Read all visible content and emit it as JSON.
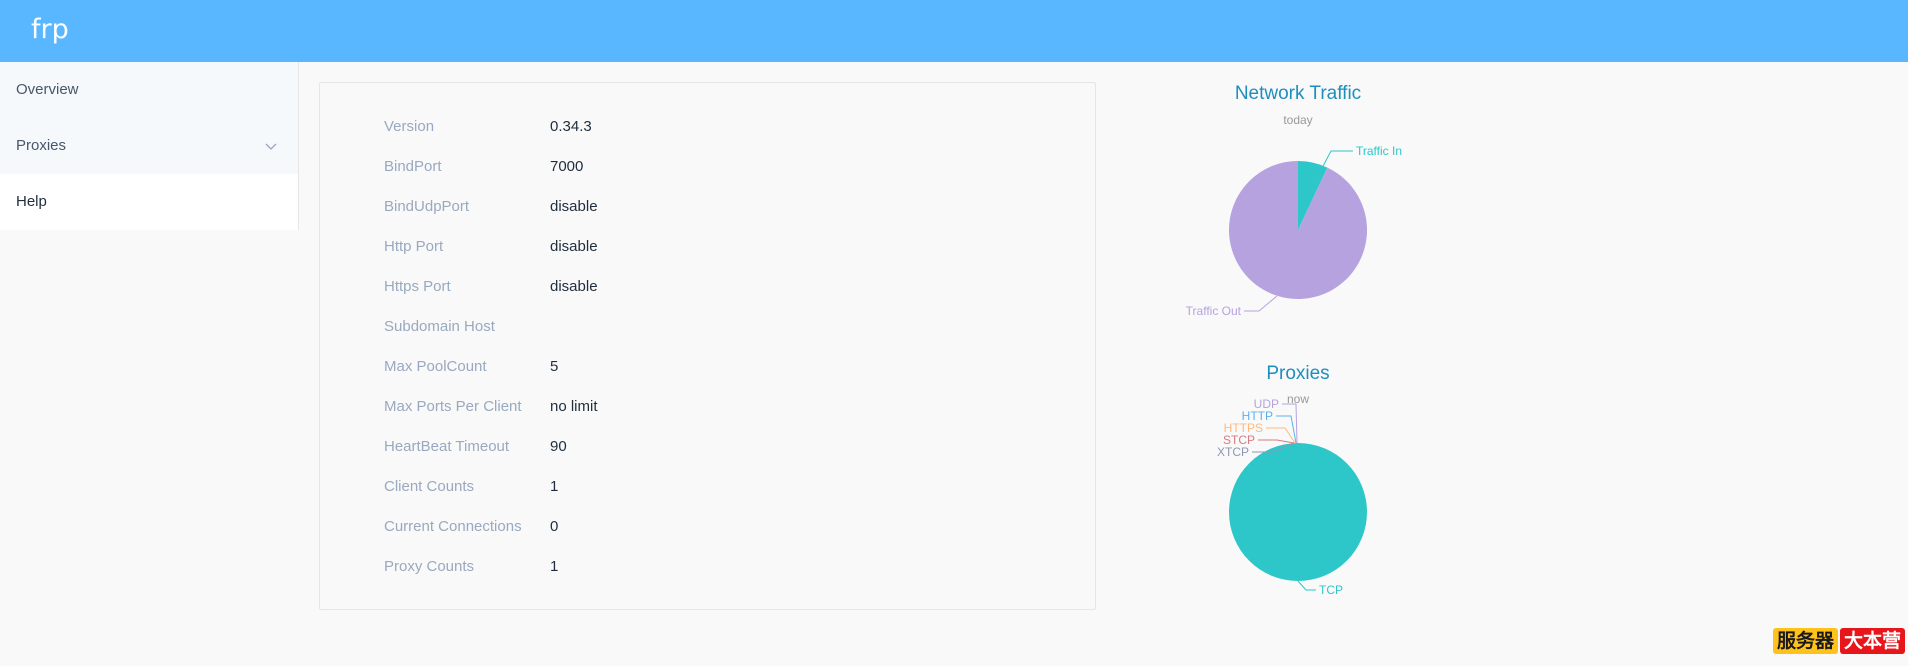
{
  "app": {
    "title": "frp"
  },
  "sidebar": {
    "items": [
      {
        "label": "Overview"
      },
      {
        "label": "Proxies"
      },
      {
        "label": "Help"
      }
    ]
  },
  "server_info": [
    {
      "label": "Version",
      "value": "0.34.3"
    },
    {
      "label": "BindPort",
      "value": "7000"
    },
    {
      "label": "BindUdpPort",
      "value": "disable"
    },
    {
      "label": "Http Port",
      "value": "disable"
    },
    {
      "label": "Https Port",
      "value": "disable"
    },
    {
      "label": "Subdomain Host",
      "value": ""
    },
    {
      "label": "Max PoolCount",
      "value": "5"
    },
    {
      "label": "Max Ports Per Client",
      "value": "no limit"
    },
    {
      "label": "HeartBeat Timeout",
      "value": "90"
    },
    {
      "label": "Client Counts",
      "value": "1"
    },
    {
      "label": "Current Connections",
      "value": "0"
    },
    {
      "label": "Proxy Counts",
      "value": "1"
    }
  ],
  "watermark": {
    "part1": "服务器",
    "part2": "大本营"
  },
  "chart_data": [
    {
      "type": "pie",
      "title": "Network Traffic",
      "subtitle": "today",
      "slices": [
        {
          "label": "Traffic In",
          "value": 7,
          "color": "#2ec7c9"
        },
        {
          "label": "Traffic Out",
          "value": 93,
          "color": "#b6a2de"
        }
      ]
    },
    {
      "type": "pie",
      "title": "Proxies",
      "subtitle": "now",
      "slices": [
        {
          "label": "TCP",
          "value": 1,
          "color": "#2ec7c9"
        },
        {
          "label": "UDP",
          "value": 0,
          "color": "#b6a2de"
        },
        {
          "label": "HTTP",
          "value": 0,
          "color": "#5ab1ef"
        },
        {
          "label": "HTTPS",
          "value": 0,
          "color": "#ffb980"
        },
        {
          "label": "STCP",
          "value": 0,
          "color": "#d87a80"
        },
        {
          "label": "XTCP",
          "value": 0,
          "color": "#8d98b3"
        }
      ]
    }
  ]
}
